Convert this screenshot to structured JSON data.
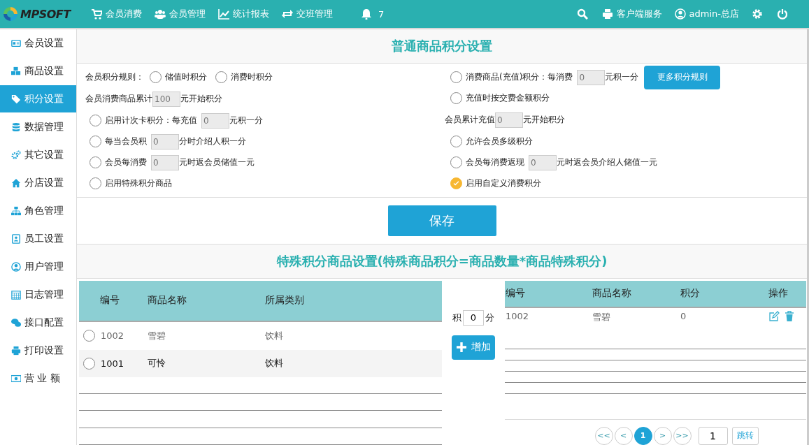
{
  "header": {
    "logo": "MPSOFT",
    "nav": [
      {
        "label": "会员消费"
      },
      {
        "label": "会员管理"
      },
      {
        "label": "统计报表"
      },
      {
        "label": "交班管理"
      }
    ],
    "bell_count": "7",
    "client_service": "客户端服务",
    "user": "admin-总店"
  },
  "sidebar": {
    "items": [
      {
        "label": "会员设置",
        "selected": false
      },
      {
        "label": "商品设置",
        "selected": false
      },
      {
        "label": "积分设置",
        "selected": true
      },
      {
        "label": "数据管理",
        "selected": false
      },
      {
        "label": "其它设置",
        "selected": false
      },
      {
        "label": "分店设置",
        "selected": false
      },
      {
        "label": "角色管理",
        "selected": false
      },
      {
        "label": "员工设置",
        "selected": false
      },
      {
        "label": "用户管理",
        "selected": false
      },
      {
        "label": "日志管理",
        "selected": false
      },
      {
        "label": "接口配置",
        "selected": false
      },
      {
        "label": "打印设置",
        "selected": false
      },
      {
        "label": "营 业 额",
        "selected": false
      }
    ]
  },
  "points_settings": {
    "title": "普通商品积分设置",
    "left_rules": [
      {
        "kind": "group",
        "label": "会员积分规则：",
        "options": [
          {
            "label": "储值时积分",
            "checked": false
          },
          {
            "label": "消费时积分",
            "checked": false
          }
        ]
      },
      {
        "kind": "plain",
        "before": "会员消费商品累计",
        "value": "100",
        "after": "元开始积分"
      },
      {
        "kind": "radio",
        "checked": false,
        "before": "启用计次卡积分：每充值",
        "value": "0",
        "after": "元积一分"
      },
      {
        "kind": "radio",
        "checked": false,
        "before": "每当会员积",
        "value": "0",
        "after": "分时介绍人积一分"
      },
      {
        "kind": "radio",
        "checked": false,
        "before": "会员每消费",
        "value": "0",
        "after": "元时返会员储值一元"
      },
      {
        "kind": "radio",
        "checked": false,
        "before": "启用特殊积分商品"
      }
    ],
    "right_rules": [
      {
        "kind": "radio",
        "checked": false,
        "before": "消费商品(充值)积分：每消费",
        "value": "0",
        "after": "元积一分",
        "button": "更多积分规则"
      },
      {
        "kind": "radio",
        "checked": false,
        "before": "充值时按交费金额积分"
      },
      {
        "kind": "plain",
        "before": "会员累计充值",
        "value": "0",
        "after": "元开始积分"
      },
      {
        "kind": "radio",
        "checked": false,
        "before": "允许会员多级积分"
      },
      {
        "kind": "radio",
        "checked": false,
        "before": "会员每消费返现",
        "value": "0",
        "after": "元时返会员介绍人储值一元"
      },
      {
        "kind": "radio",
        "checked": true,
        "before": "启用自定义消费积分"
      }
    ],
    "save_button": "保存"
  },
  "special": {
    "title": "特殊积分商品设置(特殊商品积分=商品数量*商品特殊积分)",
    "goods_table": {
      "columns": [
        "编号",
        "商品名称",
        "所属类别"
      ],
      "rows": [
        {
          "selected": false,
          "highlighted": false,
          "cells": [
            "1002",
            "雪碧",
            "饮料"
          ]
        },
        {
          "selected": false,
          "highlighted": true,
          "cells": [
            "1001",
            "可怜",
            "饮料"
          ]
        }
      ]
    },
    "points_prefix": "积",
    "points_value": "0",
    "points_suffix": "分",
    "add_button": "增加",
    "special_table": {
      "columns": [
        "编号",
        "商品名称",
        "积分",
        "操作"
      ],
      "rows": [
        {
          "cells": [
            "1002",
            "雪碧",
            "0"
          ]
        }
      ]
    },
    "pagination": {
      "pages": [
        {
          "label": "<<",
          "selected": false
        },
        {
          "label": "<",
          "selected": false
        },
        {
          "label": "1",
          "selected": true
        },
        {
          "label": ">",
          "selected": false
        },
        {
          "label": ">>",
          "selected": false
        }
      ],
      "jump_value": "1",
      "jump_button": "跳转"
    }
  }
}
